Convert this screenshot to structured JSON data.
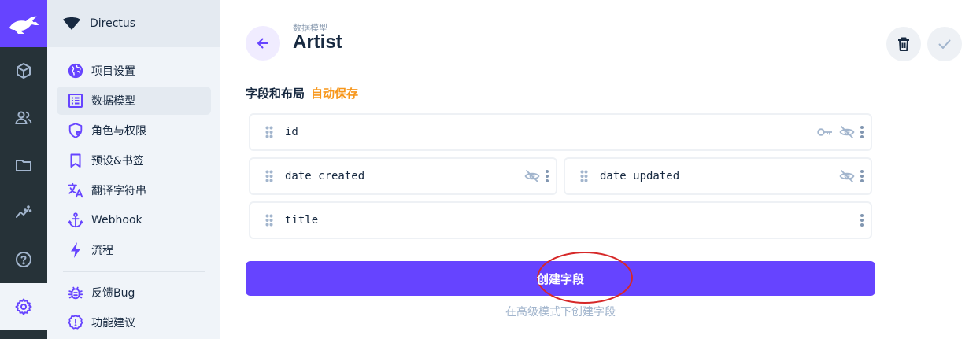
{
  "modules": [
    {
      "icon": "box-icon",
      "label": "content"
    },
    {
      "icon": "users-icon",
      "label": "users"
    },
    {
      "icon": "folder-icon",
      "label": "files"
    },
    {
      "icon": "insights-icon",
      "label": "insights"
    },
    {
      "icon": "help-icon",
      "label": "docs"
    },
    {
      "icon": "gear-icon",
      "label": "settings",
      "active": true
    }
  ],
  "project": {
    "name": "Directus"
  },
  "nav": {
    "items": [
      {
        "label": "项目设置",
        "icon": "globe-icon"
      },
      {
        "label": "数据模型",
        "icon": "list-alt-icon",
        "active": true
      },
      {
        "label": "角色与权限",
        "icon": "shield-icon"
      },
      {
        "label": "预设&书签",
        "icon": "bookmark-icon"
      },
      {
        "label": "翻译字符串",
        "icon": "translate-icon"
      },
      {
        "label": "Webhook",
        "icon": "anchor-icon"
      },
      {
        "label": "流程",
        "icon": "bolt-icon"
      }
    ],
    "footer_items": [
      {
        "label": "反馈Bug",
        "icon": "bug-icon"
      },
      {
        "label": "功能建议",
        "icon": "idea-icon"
      }
    ]
  },
  "header": {
    "breadcrumb": "数据模型",
    "title": "Artist"
  },
  "fields_section": {
    "title": "字段和布局",
    "autosave": "自动保存"
  },
  "fields": [
    {
      "name": "id",
      "icons": [
        "key-icon",
        "hidden-icon",
        "more-icon"
      ]
    },
    {
      "name": "date_created",
      "icons": [
        "hidden-icon",
        "more-icon"
      ]
    },
    {
      "name": "date_updated",
      "icons": [
        "hidden-icon",
        "more-icon"
      ]
    },
    {
      "name": "title",
      "icons": [
        "more-icon"
      ]
    }
  ],
  "create_button": {
    "label": "创建字段"
  },
  "advanced_link": {
    "label": "在高级模式下创建字段"
  },
  "colors": {
    "primary": "#6644ff",
    "module_bar": "#263238",
    "nav_bg": "#f0f4f9",
    "autosave": "#f7971c",
    "highlight": "#d62828"
  }
}
